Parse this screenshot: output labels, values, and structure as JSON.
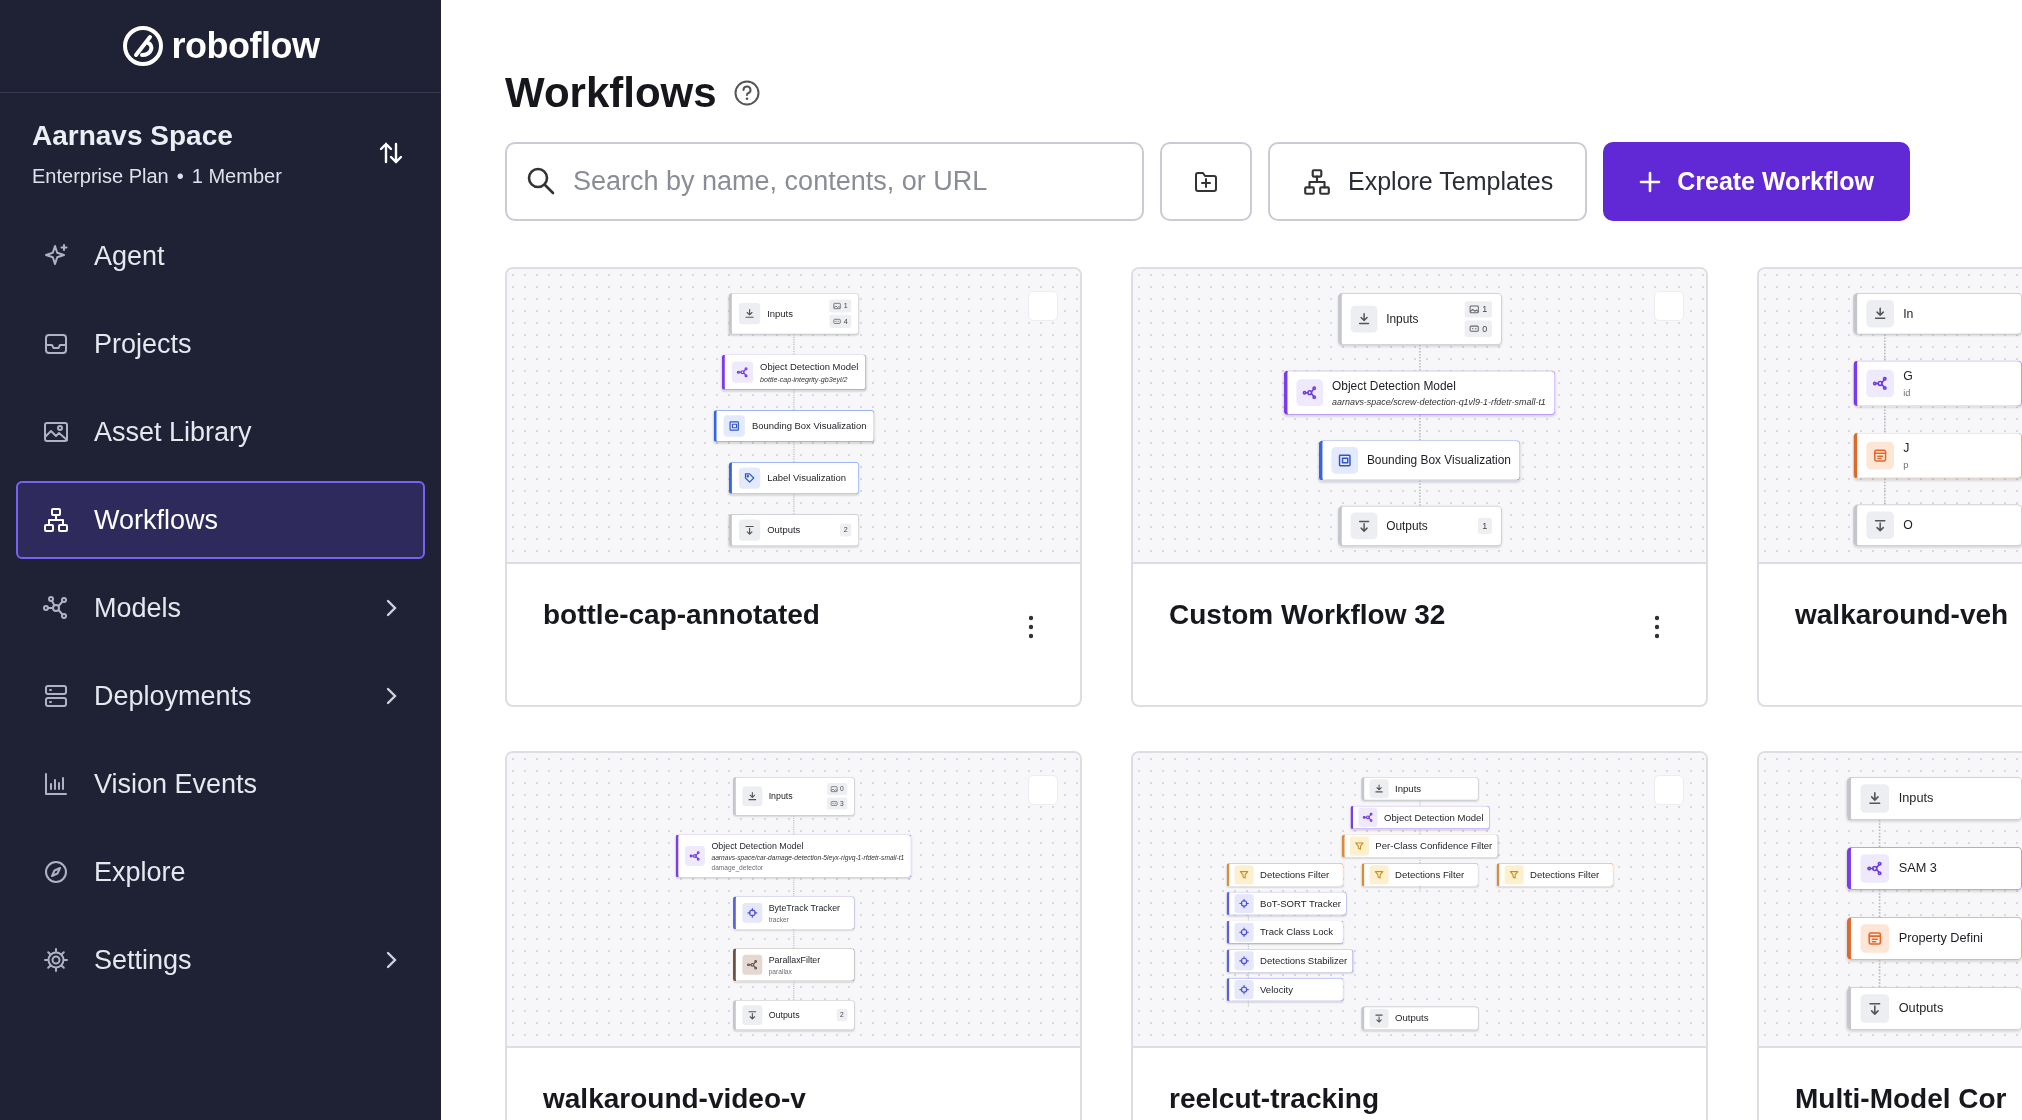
{
  "sidebar": {
    "brand": "roboflow",
    "workspace": {
      "name": "Aarnavs Space",
      "plan": "Enterprise Plan",
      "separator": "•",
      "members": "1 Member"
    },
    "items": [
      {
        "label": "Agent",
        "selected": false,
        "expandable": false
      },
      {
        "label": "Projects",
        "selected": false,
        "expandable": false
      },
      {
        "label": "Asset Library",
        "selected": false,
        "expandable": false
      },
      {
        "label": "Workflows",
        "selected": true,
        "expandable": false
      },
      {
        "label": "Models",
        "selected": false,
        "expandable": true
      },
      {
        "label": "Deployments",
        "selected": false,
        "expandable": true
      },
      {
        "label": "Vision Events",
        "selected": false,
        "expandable": false
      },
      {
        "label": "Explore",
        "selected": false,
        "expandable": false
      },
      {
        "label": "Settings",
        "selected": false,
        "expandable": true
      }
    ]
  },
  "header": {
    "title": "Workflows",
    "search": {
      "placeholder": "Search by name, contents, or URL"
    },
    "buttons": [
      {
        "kind": "folder"
      },
      {
        "kind": "templates",
        "label": "Explore Templates"
      },
      {
        "kind": "create",
        "label": "Create Workflow"
      }
    ]
  },
  "workflows": [
    {
      "name": "bottle-cap-annotated",
      "checked": false,
      "menu": true,
      "rows": [
        [
          {
            "kind": "io",
            "title": "Inputs",
            "badges": [
              {
                "kind": "image",
                "value": "1"
              },
              {
                "kind": "param",
                "value": "4"
              }
            ]
          }
        ],
        [
          {
            "kind": "model",
            "title": "Object Detection Model",
            "model_id": "bottle-cap-integrity-gb3eyl/2"
          }
        ],
        [
          {
            "kind": "visualization",
            "title": "Bounding Box Visualization"
          }
        ],
        [
          {
            "kind": "label",
            "title": "Label Visualization"
          }
        ],
        [
          {
            "kind": "output",
            "title": "Outputs",
            "badges": [
              {
                "value": "2"
              }
            ]
          }
        ]
      ]
    },
    {
      "name": "Custom Workflow 32",
      "checked": false,
      "menu": true,
      "rows": [
        [
          {
            "kind": "io",
            "title": "Inputs",
            "badges": [
              {
                "kind": "image",
                "value": "1"
              },
              {
                "kind": "param",
                "value": "0"
              }
            ]
          }
        ],
        [
          {
            "kind": "model",
            "title": "Object Detection Model",
            "model_id": "aarnavs-space/screw-detection-q1vl9-1-rfdetr-small-t1"
          }
        ],
        [
          {
            "kind": "visualization",
            "title": "Bounding Box Visualization"
          }
        ],
        [
          {
            "kind": "output",
            "title": "Outputs",
            "badges": [
              {
                "value": "1"
              }
            ]
          }
        ]
      ]
    },
    {
      "name": "walkaround-veh",
      "rows": [
        [
          {
            "kind": "io",
            "title": "In"
          }
        ],
        [
          {
            "kind": "model",
            "title": "G",
            "subtitle": "id"
          }
        ],
        [
          {
            "kind": "formatter",
            "title": "J",
            "subtitle": "p"
          }
        ],
        [
          {
            "kind": "output",
            "title": "O"
          }
        ]
      ]
    },
    {
      "name": "walkaround-video-v",
      "checked": false,
      "menu": false,
      "rows": [
        [
          {
            "kind": "io",
            "title": "Inputs",
            "badges": [
              {
                "kind": "image",
                "value": "0"
              },
              {
                "kind": "param",
                "value": "3"
              }
            ]
          }
        ],
        [
          {
            "kind": "model",
            "title": "Object Detection Model",
            "model_id": "aarnavs-space/car-damage-detection-5leyx-rigvq-1-rfdetr-small-t1",
            "subtitle": "damage_detector"
          }
        ],
        [
          {
            "kind": "tracker",
            "title": "ByteTrack Tracker",
            "subtitle": "tracker"
          }
        ],
        [
          {
            "kind": "custom",
            "title": "ParallaxFilter",
            "subtitle": "parallax"
          }
        ],
        [
          {
            "kind": "output",
            "title": "Outputs",
            "badges": [
              {
                "value": "2"
              }
            ]
          }
        ]
      ]
    },
    {
      "name": "reelcut-tracking",
      "checked": false,
      "menu": false,
      "rows": [
        [
          {
            "kind": "io",
            "title": "Inputs"
          }
        ],
        [
          {
            "kind": "model",
            "title": "Object Detection Model"
          }
        ],
        [
          {
            "kind": "filter",
            "title": "Per-Class Confidence Filter"
          }
        ],
        [
          {
            "kind": "filter",
            "title": "Detections Filter"
          },
          {
            "kind": "filter",
            "title": "Detections Filter"
          },
          {
            "kind": "filter",
            "title": "Detections Filter"
          }
        ],
        [
          {
            "kind": "tracker",
            "title": "BoT-SORT Tracker"
          }
        ],
        [
          {
            "kind": "tracker",
            "title": "Track Class Lock"
          }
        ],
        [
          {
            "kind": "tracker",
            "title": "Detections Stabilizer"
          }
        ],
        [
          {
            "kind": "tracker",
            "title": "Velocity"
          }
        ],
        [
          {
            "kind": "output",
            "title": "Outputs"
          }
        ]
      ]
    },
    {
      "name": "Multi-Model Cor",
      "rows": [
        [
          {
            "kind": "io",
            "title": "Inputs"
          }
        ],
        [
          {
            "kind": "model",
            "title": "SAM 3"
          }
        ],
        [
          {
            "kind": "formatter",
            "title": "Property Defini"
          }
        ],
        [
          {
            "kind": "output",
            "title": "Outputs"
          }
        ]
      ]
    }
  ]
}
